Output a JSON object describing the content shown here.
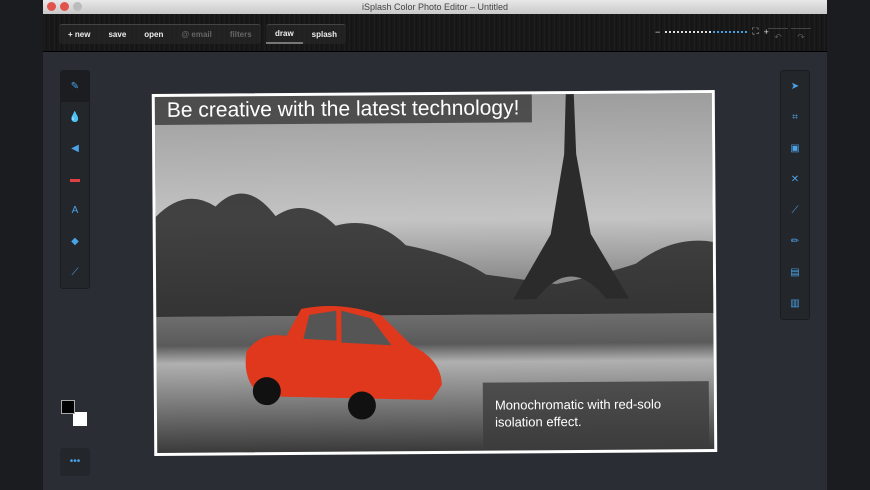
{
  "window": {
    "title": "iSplash Color Photo Editor – Untitled"
  },
  "toolbar": {
    "file_buttons": [
      {
        "label": "new",
        "icon": "plus-icon"
      },
      {
        "label": "save"
      },
      {
        "label": "open"
      },
      {
        "label": "email",
        "icon": "at-icon",
        "disabled": true
      },
      {
        "label": "filters",
        "disabled": true
      }
    ],
    "mode_buttons": [
      {
        "label": "draw",
        "active": true
      },
      {
        "label": "splash"
      }
    ],
    "zoom": {
      "minus": "−",
      "plus": "+",
      "level": 0.55,
      "fit_icon": "⛶"
    },
    "undo": "↶",
    "redo": "↷"
  },
  "left_tools": [
    "brush-icon",
    "drop-icon",
    "back-arrow-icon",
    "eraser-icon",
    "text-icon",
    "bucket-icon",
    "eyedropper-icon"
  ],
  "right_tools": [
    "cursor-icon",
    "crop-icon",
    "compare-icon",
    "close-x-icon",
    "wand-icon",
    "pencil-icon",
    "layers-icon",
    "export-icon"
  ],
  "canvas": {
    "headline": "Be creative with the latest technology!",
    "caption": "Monochromatic with red-solo isolation effect."
  },
  "colors": {
    "foreground": "#000000",
    "background": "#ffffff",
    "accent": "#3fa2e0",
    "car": "#e0381c"
  },
  "more_icon": "•••"
}
